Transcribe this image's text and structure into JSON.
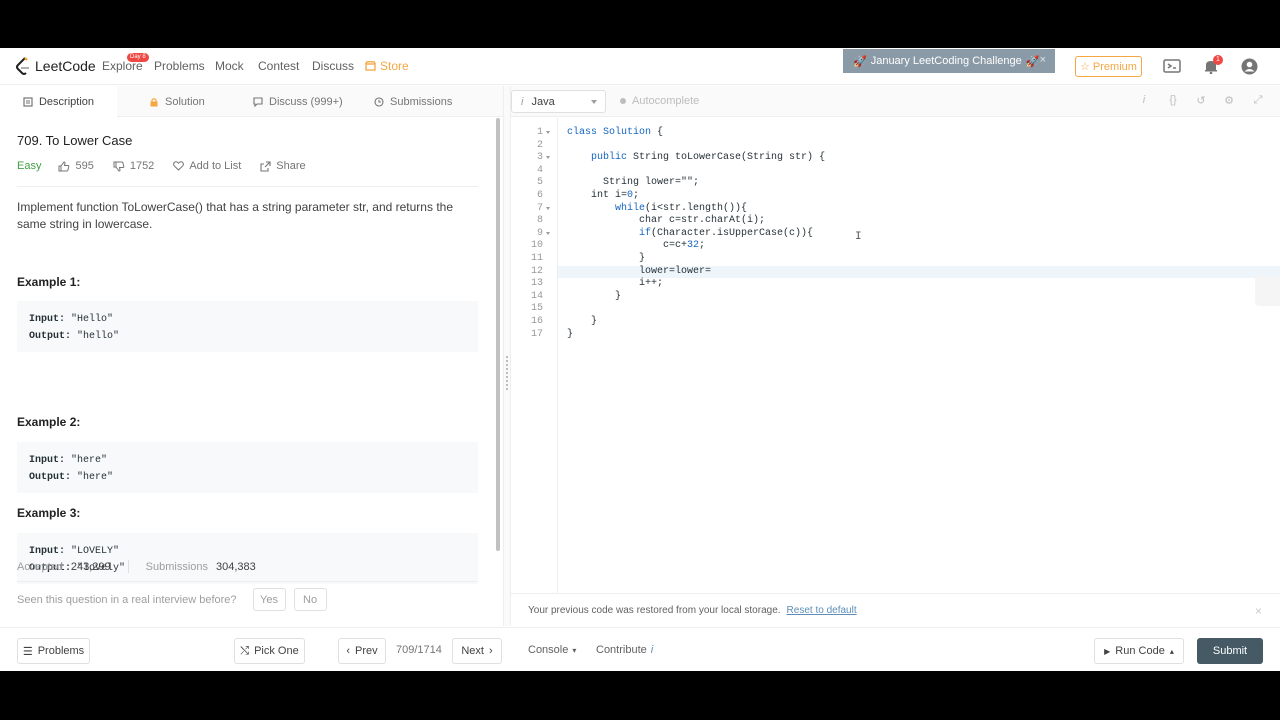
{
  "nav": {
    "logo_text": "LeetCode",
    "explore": "Explore",
    "explore_badge": "Day 8",
    "problems": "Problems",
    "mock": "Mock",
    "contest": "Contest",
    "discuss": "Discuss",
    "store": "Store",
    "challenge": "January LeetCoding Challenge",
    "challenge_close": "×",
    "premium": "Premium",
    "notification_count": "1"
  },
  "tabs": {
    "description": "Description",
    "solution": "Solution",
    "discuss": "Discuss (999+)",
    "submissions": "Submissions"
  },
  "problem": {
    "title": "709. To Lower Case",
    "difficulty": "Easy",
    "likes": "595",
    "dislikes": "1752",
    "add_to_list": "Add to List",
    "share": "Share",
    "description": "Implement function ToLowerCase() that has a string parameter str, and returns the same string in lowercase.",
    "examples": [
      {
        "heading": "Example 1:",
        "input_label": "Input:",
        "input": " \"Hello\"",
        "output_label": "Output:",
        "output": " \"hello\""
      },
      {
        "heading": "Example 2:",
        "input_label": "Input:",
        "input": " \"here\"",
        "output_label": "Output:",
        "output": " \"here\""
      },
      {
        "heading": "Example 3:",
        "input_label": "Input:",
        "input": " \"LOVELY\"",
        "output_label": "Output:",
        "output": " \"lovely\""
      }
    ],
    "accepted_label": "Accepted",
    "accepted": "243,299",
    "submissions_label": "Submissions",
    "submissions": "304,383",
    "interview_question": "Seen this question in a real interview before?",
    "yes": "Yes",
    "no": "No"
  },
  "editor": {
    "language": "Java",
    "autocomplete": "Autocomplete",
    "lines": [
      "class Solution {",
      "",
      "    public String toLowerCase(String str) {",
      "",
      "      String lower=\"\";",
      "    int i=0;",
      "        while(i<str.length()){",
      "            char c=str.charAt(i);",
      "            if(Character.isUpperCase(c)){",
      "                c=c+32;",
      "            }",
      "            lower=lower=",
      "            i++;",
      "        }",
      "",
      "    }",
      "}"
    ],
    "folds": [
      1,
      3,
      7,
      9
    ],
    "active_line": 12,
    "restore_message": "Your previous code was restored from your local storage.",
    "reset_link": "Reset to default",
    "restore_close": "×"
  },
  "bottom": {
    "problems": "Problems",
    "pick_one": "Pick One",
    "prev": "Prev",
    "page": "709/1714",
    "next": "Next",
    "console": "Console",
    "contribute": "Contribute",
    "run_code": "Run Code",
    "submit": "Submit"
  },
  "colors": {
    "accent_store": "#f4a742",
    "easy": "#43a047",
    "submit_bg": "#455a64",
    "challenge_bg": "#8a9aa6"
  }
}
